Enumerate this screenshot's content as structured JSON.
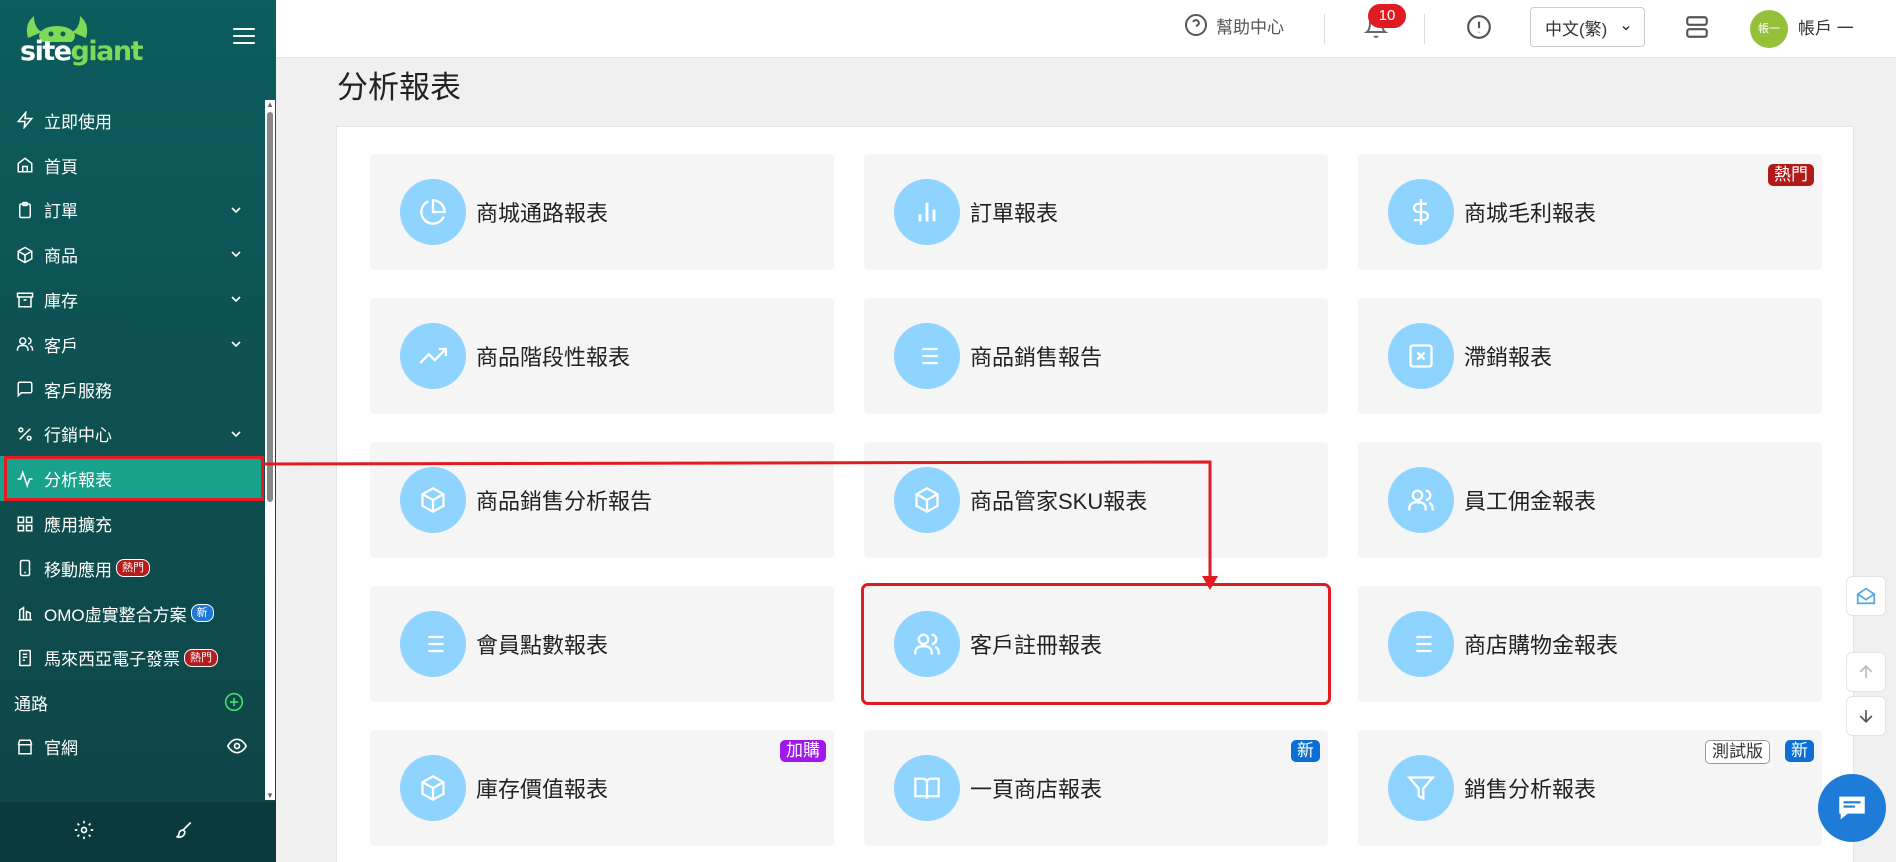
{
  "brand": {
    "logo_text_a": "site",
    "logo_text_b": "giant"
  },
  "sidebar": {
    "items": [
      {
        "label": "立即使用",
        "icon": "bolt-icon"
      },
      {
        "label": "首頁",
        "icon": "home-icon"
      },
      {
        "label": "訂單",
        "icon": "clipboard-icon",
        "expandable": true
      },
      {
        "label": "商品",
        "icon": "box-icon",
        "expandable": true
      },
      {
        "label": "庫存",
        "icon": "archive-icon",
        "expandable": true
      },
      {
        "label": "客戶",
        "icon": "users-icon",
        "expandable": true
      },
      {
        "label": "客戶服務",
        "icon": "message-icon"
      },
      {
        "label": "行銷中心",
        "icon": "percent-icon",
        "expandable": true
      },
      {
        "label": "分析報表",
        "icon": "activity-icon",
        "active": true
      },
      {
        "label": "應用擴充",
        "icon": "grid-icon"
      },
      {
        "label": "移動應用",
        "icon": "mobile-icon",
        "badge": "熱門"
      },
      {
        "label": "OMO虛實整合方案",
        "icon": "building-icon",
        "badge": "新"
      },
      {
        "label": "馬來西亞電子發票",
        "icon": "receipt-icon",
        "badge": "熱門"
      }
    ],
    "section_label": "通路",
    "channel_item": "官網"
  },
  "topbar": {
    "help": "幫助中心",
    "notifications": "10",
    "language": "中文(繁)",
    "avatar_text": "帳一",
    "account": "帳戶 一"
  },
  "page": {
    "title": "分析報表"
  },
  "reports": [
    {
      "label": "商城通路報表",
      "icon": "pie-chart-icon"
    },
    {
      "label": "訂單報表",
      "icon": "bar-chart-icon"
    },
    {
      "label": "商城毛利報表",
      "icon": "dollar-icon",
      "tags": [
        "熱門"
      ]
    },
    {
      "label": "商品階段性報表",
      "icon": "trending-up-icon"
    },
    {
      "label": "商品銷售報告",
      "icon": "list-icon"
    },
    {
      "label": "滯銷報表",
      "icon": "x-square-icon"
    },
    {
      "label": "商品銷售分析報告",
      "icon": "box-icon"
    },
    {
      "label": "商品管家SKU報表",
      "icon": "box-icon"
    },
    {
      "label": "員工佣金報表",
      "icon": "users-icon"
    },
    {
      "label": "會員點數報表",
      "icon": "list-icon"
    },
    {
      "label": "客戶註冊報表",
      "icon": "users-icon",
      "highlighted": true
    },
    {
      "label": "商店購物金報表",
      "icon": "list-icon"
    },
    {
      "label": "庫存價值報表",
      "icon": "box-icon",
      "tags": [
        "加購"
      ]
    },
    {
      "label": "一頁商店報表",
      "icon": "book-icon",
      "tags": [
        "新"
      ]
    },
    {
      "label": "銷售分析報表",
      "icon": "filter-icon",
      "tags": [
        "測試版",
        "新"
      ]
    }
  ],
  "colors": {
    "sidebar": "#0c5d5e",
    "active": "#19a28b",
    "annotation": "#e01b22",
    "icon_circle": "#8fd3ff"
  }
}
